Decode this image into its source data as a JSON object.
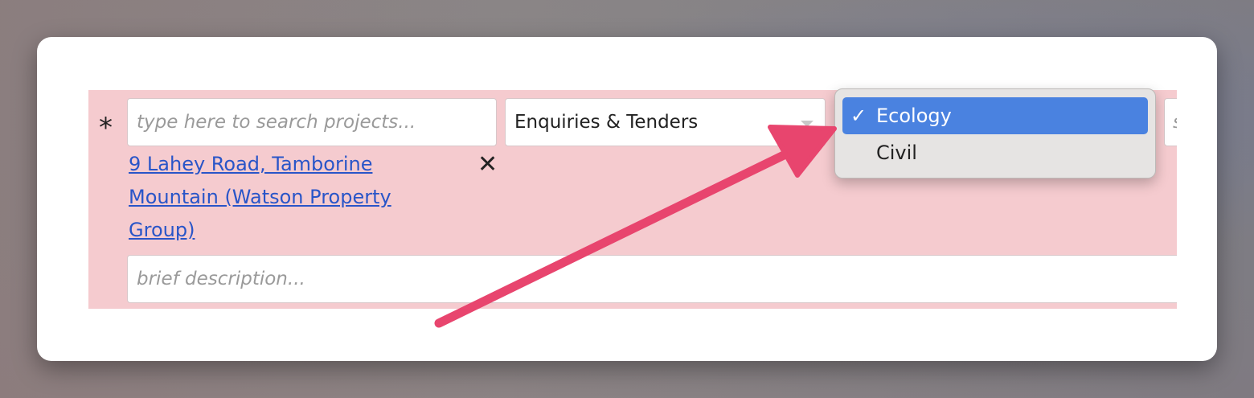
{
  "form": {
    "required_marker": "*",
    "project_search": {
      "placeholder": "type here to search projects..."
    },
    "selected_project": "9 Lahey Road, Tamborine Mountain (Watson Property Group)",
    "remove_symbol": "✕",
    "type_select": {
      "value": "Enquiries & Tenders"
    },
    "description": {
      "placeholder": "brief description..."
    },
    "next_select": {
      "partial_text": "s"
    }
  },
  "dropdown": {
    "check_mark": "✓",
    "options": [
      {
        "label": "Ecology",
        "selected": true
      },
      {
        "label": "Civil",
        "selected": false
      }
    ]
  },
  "colors": {
    "row_background": "#f5cbcf",
    "link": "#2955c8",
    "selected_option": "#4a82e0",
    "annotation_arrow": "#e8456e"
  },
  "icons": {
    "remove": "close-icon",
    "check": "checkmark-icon",
    "caret": "chevron-down-icon",
    "annotation": "arrow-icon"
  }
}
